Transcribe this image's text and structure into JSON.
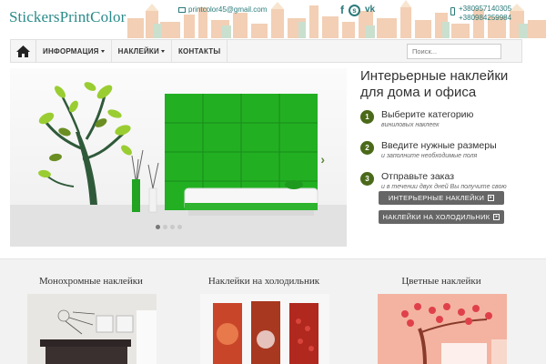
{
  "header": {
    "logo_text": "StickersPrintColor",
    "email": "printcolor45@gmail.com",
    "phones": [
      "+380957140305",
      "+380984259984"
    ],
    "socials": [
      "facebook-icon",
      "skype-icon",
      "vk-icon"
    ]
  },
  "nav": {
    "items": [
      {
        "label": "ИНФОРМАЦИЯ",
        "dropdown": true
      },
      {
        "label": "НАКЛЕЙКИ",
        "dropdown": true
      },
      {
        "label": "КОНТАКТЫ",
        "dropdown": false
      }
    ],
    "search_placeholder": "Поиск..."
  },
  "slider": {
    "slides_count": 4,
    "active_slide": 1
  },
  "info": {
    "title": "Интерьерные наклейки для дома и офиса",
    "steps": [
      {
        "num": "1",
        "title": "Выберите категорию",
        "sub": "виниловых наклеек"
      },
      {
        "num": "2",
        "title": "Введите нужные размеры",
        "sub": "и заполните необходимые поля"
      },
      {
        "num": "3",
        "title": "Отправьте заказ",
        "sub": "и в течении двух дней Вы получите свою наклейку"
      }
    ],
    "buttons": [
      "ИНТЕРЬЕРНЫЕ НАКЛЕЙКИ",
      "НАКЛЕЙКИ НА ХОЛОДИЛЬНИК"
    ]
  },
  "categories": [
    {
      "title": "Монохромные наклейки"
    },
    {
      "title": "Наклейки на холодильник"
    },
    {
      "title": "Цветные наклейки"
    }
  ],
  "colors": {
    "accent": "#2a8a8a",
    "step_badge": "#4a6a1a",
    "button": "#666666"
  }
}
